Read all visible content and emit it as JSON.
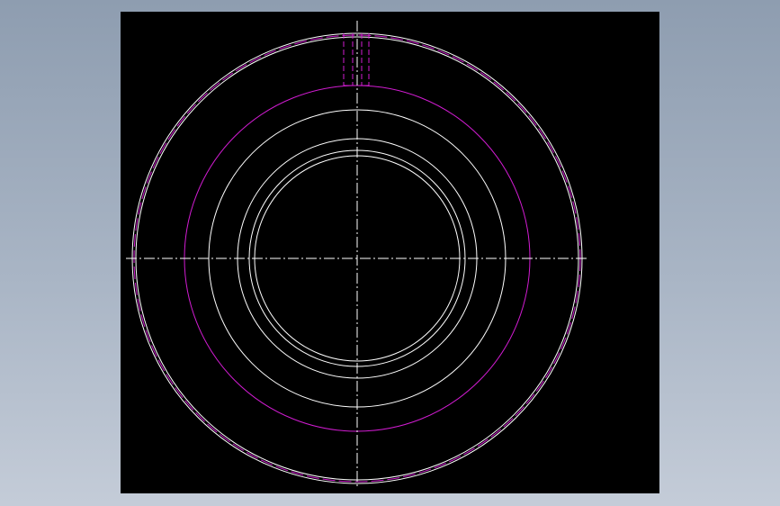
{
  "colors": {
    "page_background_top": "#8e9db0",
    "page_background_bottom": "#c4ccd8",
    "viewport_background": "#000000",
    "outline_color": "#ffffff",
    "hidden_line_color": "#d21cd2",
    "centerline_color": "#ffffff"
  },
  "drawing": {
    "type": "cad-front-view",
    "elements": [
      "outer-rim-circle",
      "outer-rim-inner-circle",
      "pitch-circle",
      "hub-outer-circle",
      "bore-chamfer-circle",
      "bore-ring-circle",
      "bore-circle",
      "keyway-slot",
      "horizontal-centerline",
      "vertical-centerline"
    ]
  }
}
